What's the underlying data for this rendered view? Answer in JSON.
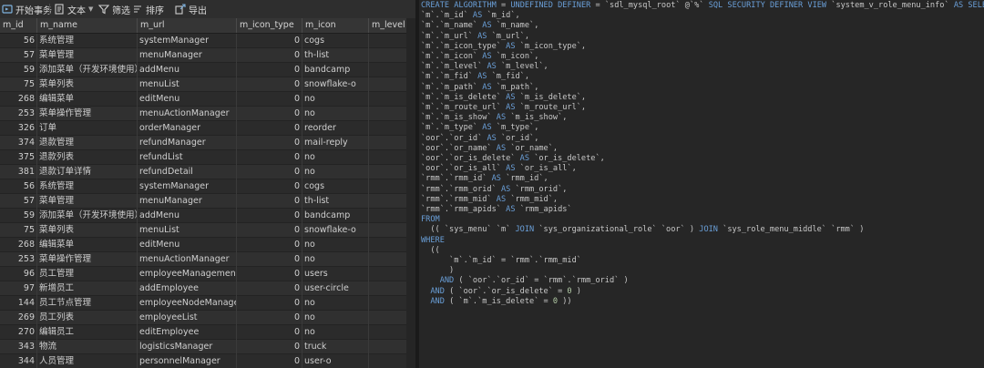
{
  "toolbar": {
    "begin_transaction": "开始事务",
    "text": "文本",
    "filter": "筛选",
    "sort": "排序",
    "export": "导出"
  },
  "columns": [
    "m_id",
    "m_name",
    "m_url",
    "m_icon_type",
    "m_icon",
    "m_level"
  ],
  "rows": [
    {
      "id": "56",
      "name": "系统管理",
      "url": "systemManager",
      "type": "0",
      "icon": "cogs"
    },
    {
      "id": "57",
      "name": "菜单管理",
      "url": "menuManager",
      "type": "0",
      "icon": "th-list"
    },
    {
      "id": "59",
      "name": "添加菜单（开发环境使用）",
      "url": "addMenu",
      "type": "0",
      "icon": "bandcamp"
    },
    {
      "id": "75",
      "name": "菜单列表",
      "url": "menuList",
      "type": "0",
      "icon": "snowflake-o"
    },
    {
      "id": "268",
      "name": "编辑菜单",
      "url": "editMenu",
      "type": "0",
      "icon": "no"
    },
    {
      "id": "253",
      "name": "菜单操作管理",
      "url": "menuActionManager",
      "type": "0",
      "icon": "no"
    },
    {
      "id": "326",
      "name": "订单",
      "url": "orderManager",
      "type": "0",
      "icon": "reorder"
    },
    {
      "id": "374",
      "name": "退款管理",
      "url": "refundManager",
      "type": "0",
      "icon": "mail-reply"
    },
    {
      "id": "375",
      "name": "退款列表",
      "url": "refundList",
      "type": "0",
      "icon": "no"
    },
    {
      "id": "381",
      "name": "退款订单详情",
      "url": "refundDetail",
      "type": "0",
      "icon": "no"
    },
    {
      "id": "56",
      "name": "系统管理",
      "url": "systemManager",
      "type": "0",
      "icon": "cogs"
    },
    {
      "id": "57",
      "name": "菜单管理",
      "url": "menuManager",
      "type": "0",
      "icon": "th-list"
    },
    {
      "id": "59",
      "name": "添加菜单（开发环境使用）",
      "url": "addMenu",
      "type": "0",
      "icon": "bandcamp"
    },
    {
      "id": "75",
      "name": "菜单列表",
      "url": "menuList",
      "type": "0",
      "icon": "snowflake-o"
    },
    {
      "id": "268",
      "name": "编辑菜单",
      "url": "editMenu",
      "type": "0",
      "icon": "no"
    },
    {
      "id": "253",
      "name": "菜单操作管理",
      "url": "menuActionManager",
      "type": "0",
      "icon": "no"
    },
    {
      "id": "96",
      "name": "员工管理",
      "url": "employeeManagement",
      "type": "0",
      "icon": "users"
    },
    {
      "id": "97",
      "name": "新增员工",
      "url": "addEmployee",
      "type": "0",
      "icon": "user-circle"
    },
    {
      "id": "144",
      "name": "员工节点管理",
      "url": "employeeNodeManager",
      "type": "0",
      "icon": "no"
    },
    {
      "id": "269",
      "name": "员工列表",
      "url": "employeeList",
      "type": "0",
      "icon": "no"
    },
    {
      "id": "270",
      "name": "编辑员工",
      "url": "editEmployee",
      "type": "0",
      "icon": "no"
    },
    {
      "id": "343",
      "name": "物流",
      "url": "logisticsManager",
      "type": "0",
      "icon": "truck"
    },
    {
      "id": "344",
      "name": "人员管理",
      "url": "personnelManager",
      "type": "0",
      "icon": "user-o"
    }
  ],
  "sql_lines": [
    "CREATE ALGORITHM = UNDEFINED DEFINER = `sdl_mysql_root` @`%` SQL SECURITY DEFINER VIEW `system_v_role_menu_info` AS SELECT",
    "`m`.`m_id` AS `m_id`,",
    "`m`.`m_name` AS `m_name`,",
    "`m`.`m_url` AS `m_url`,",
    "`m`.`m_icon_type` AS `m_icon_type`,",
    "`m`.`m_icon` AS `m_icon`,",
    "`m`.`m_level` AS `m_level`,",
    "`m`.`m_fid` AS `m_fid`,",
    "`m`.`m_path` AS `m_path`,",
    "`m`.`m_is_delete` AS `m_is_delete`,",
    "`m`.`m_route_url` AS `m_route_url`,",
    "`m`.`m_is_show` AS `m_is_show`,",
    "`m`.`m_type` AS `m_type`,",
    "`oor`.`or_id` AS `or_id`,",
    "`oor`.`or_name` AS `or_name`,",
    "`oor`.`or_is_delete` AS `or_is_delete`,",
    "`oor`.`or_is_all` AS `or_is_all`,",
    "`rmm`.`rmm_id` AS `rmm_id`,",
    "`rmm`.`rmm_orid` AS `rmm_orid`,",
    "`rmm`.`rmm_mid` AS `rmm_mid`,",
    "`rmm`.`rmm_apids` AS `rmm_apids`",
    "FROM",
    "  (( `sys_menu` `m` JOIN `sys_organizational_role` `oor` ) JOIN `sys_role_menu_middle` `rmm` )",
    "WHERE",
    "  ((",
    "      `m`.`m_id` = `rmm`.`rmm_mid`",
    "      )",
    "    AND ( `oor`.`or_id` = `rmm`.`rmm_orid` )",
    "  AND ( `oor`.`or_is_delete` = 0 )",
    "  AND ( `m`.`m_is_delete` = 0 ))"
  ],
  "colors": {
    "keyword": "#6a9fd8",
    "number": "#b5cea8",
    "text": "#c8c8c8",
    "grid_bg": "#2b2b2b",
    "editor_bg": "#262626"
  }
}
